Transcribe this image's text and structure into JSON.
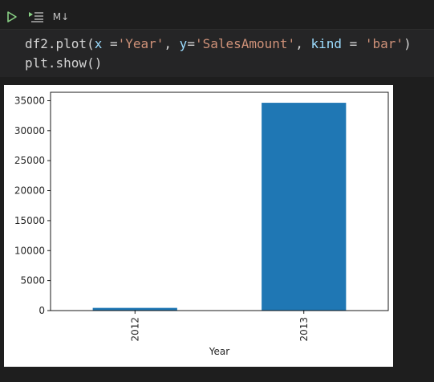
{
  "toolbar": {
    "run_icon": "play-icon",
    "run_below_icon": "run-below-icon",
    "markdown_label": "M↓"
  },
  "code": {
    "line1": {
      "t1": "df2.plot(",
      "t2": "x",
      "t3": " =",
      "t4": "'Year'",
      "t5": ", ",
      "t6": "y",
      "t7": "=",
      "t8": "'SalesAmount'",
      "t9": ", ",
      "t10": "kind",
      "t11": " = ",
      "t12": "'bar'",
      "t13": ")"
    },
    "line2": "plt.show()"
  },
  "colors": {
    "bar": "#1f77b4",
    "string": "#ce9178",
    "variable": "#9cdcfe",
    "run_icon": "#89d185"
  },
  "chart_data": {
    "type": "bar",
    "categories": [
      "2012",
      "2013"
    ],
    "values": [
      450,
      34650
    ],
    "xlabel": "Year",
    "ylabel": "",
    "ylim": [
      0,
      36400
    ],
    "yticks": [
      0,
      5000,
      10000,
      15000,
      20000,
      25000,
      30000,
      35000
    ],
    "legend": false,
    "grid": false
  }
}
